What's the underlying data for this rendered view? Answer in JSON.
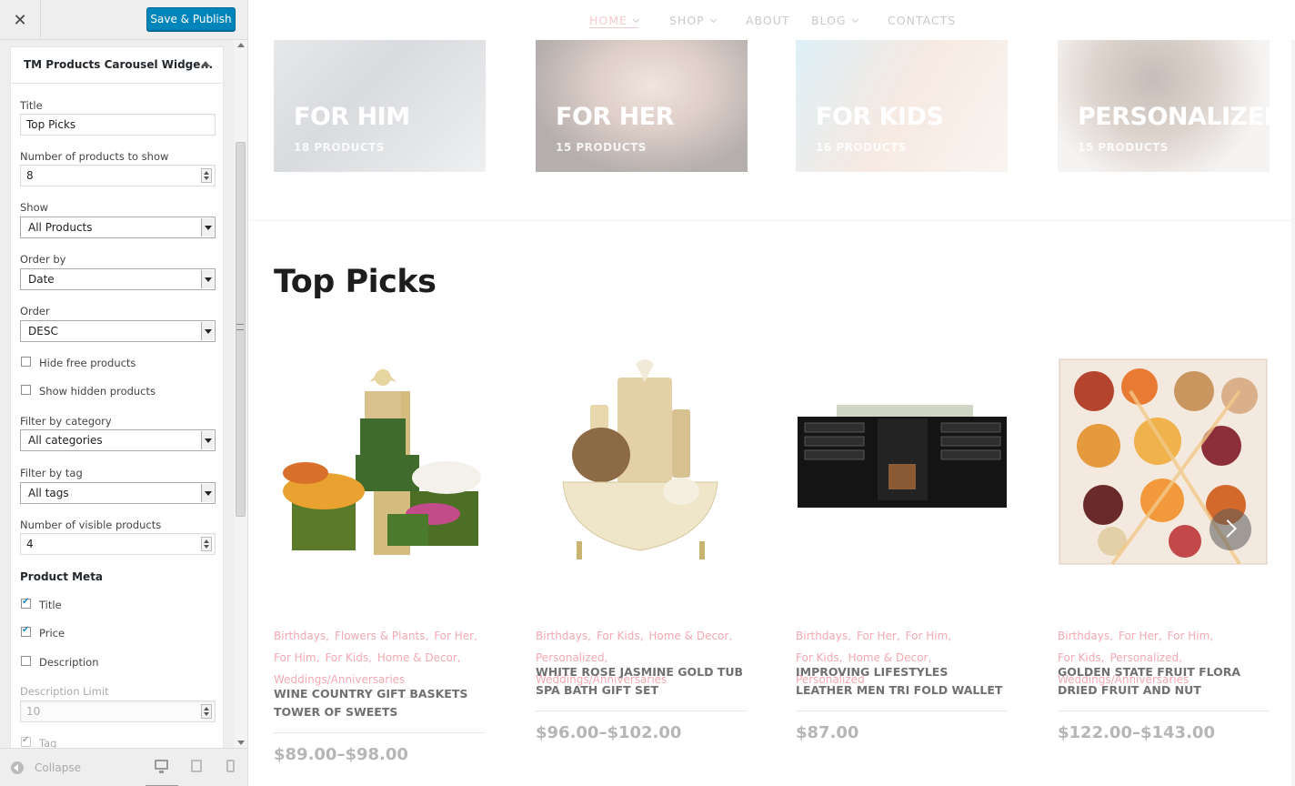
{
  "sidebar": {
    "close_icon": "close-icon",
    "publish_label": "Save & Publish",
    "widget_title": "TM Products Carousel Widge...",
    "fields": {
      "title_label": "Title",
      "title_value": "Top Picks",
      "num_products_label": "Number of products to show",
      "num_products_value": "8",
      "show_label": "Show",
      "show_value": "All Products",
      "order_by_label": "Order by",
      "order_by_value": "Date",
      "order_label": "Order",
      "order_value": "DESC",
      "hide_free_label": "Hide free products",
      "show_hidden_label": "Show hidden products",
      "filter_category_label": "Filter by category",
      "filter_category_value": "All categories",
      "filter_tag_label": "Filter by tag",
      "filter_tag_value": "All tags",
      "visible_products_label": "Number of visible products",
      "visible_products_value": "4",
      "product_meta_label": "Product Meta",
      "meta_title_label": "Title",
      "meta_price_label": "Price",
      "meta_description_label": "Description",
      "description_limit_label": "Description Limit",
      "description_limit_value": "10",
      "meta_tag_label": "Tag"
    },
    "checkboxes": {
      "hide_free": false,
      "show_hidden": false,
      "meta_title": true,
      "meta_price": true,
      "meta_description": false,
      "meta_tag": true
    },
    "footer": {
      "collapse_label": "Collapse"
    },
    "accent_color": "#0085ba"
  },
  "preview": {
    "nav": [
      "HOME",
      "SHOP",
      "ABOUT",
      "BLOG",
      "CONTACTS"
    ],
    "categories": [
      {
        "title": "FOR HIM",
        "count": "18 PRODUCTS"
      },
      {
        "title": "FOR HER",
        "count": "15 PRODUCTS"
      },
      {
        "title": "FOR KIDS",
        "count": "16 PRODUCTS"
      },
      {
        "title": "PERSONALIZED",
        "count": "15 PRODUCTS"
      }
    ],
    "section_title": "Top Picks",
    "products": [
      {
        "categories": [
          "Birthdays,",
          "Flowers & Plants,",
          "For Her,",
          "For Him,",
          "For Kids,",
          "Home & Decor,",
          "Weddings/Anniversaries"
        ],
        "name": "WINE COUNTRY GIFT BASKETS TOWER OF SWEETS",
        "price": "$89.00–$98.00"
      },
      {
        "categories": [
          "Birthdays,",
          "For Kids,",
          "Home & Decor,",
          "Personalized,",
          "Weddings/Anniversaries"
        ],
        "name": "WHITE ROSE JASMINE GOLD TUB SPA BATH GIFT SET",
        "price": "$96.00–$102.00"
      },
      {
        "categories": [
          "Birthdays,",
          "For Her,",
          "For Him,",
          "For Kids,",
          "Home & Decor,",
          "Personalized"
        ],
        "name": "IMPROVING LIFESTYLES LEATHER MEN TRI FOLD WALLET",
        "price": "$87.00"
      },
      {
        "categories": [
          "Birthdays,",
          "For Her,",
          "For Him,",
          "For Kids,",
          "Personalized,",
          "Weddings/Anniversaries"
        ],
        "name": "GOLDEN STATE FRUIT FLORA DRIED FRUIT AND NUT",
        "price": "$122.00–$143.00"
      }
    ],
    "category_link_color": "#f3a9b1",
    "price_color": "#b6b6b6"
  }
}
